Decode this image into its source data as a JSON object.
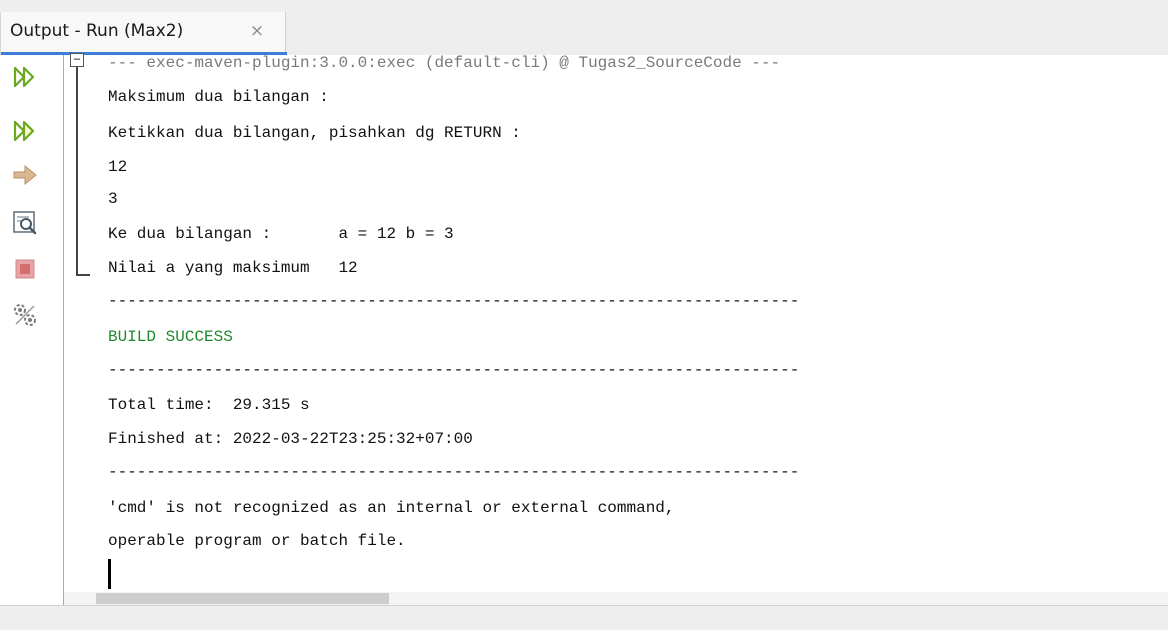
{
  "tab": {
    "title": "Output - Run (Max2)",
    "close_glyph": "×"
  },
  "toolbar": {
    "buttons": [
      {
        "name": "rerun-icon",
        "color": "#6aa820"
      },
      {
        "name": "rerun-with-params-icon",
        "color": "#6aa820"
      },
      {
        "name": "continue-arrow-icon",
        "color": "#c8a680"
      },
      {
        "name": "find-icon",
        "color": "#5d6b7a"
      },
      {
        "name": "stop-icon",
        "color": "#d06a6a"
      },
      {
        "name": "settings-icon",
        "color": "#7b7b7b"
      }
    ]
  },
  "output": {
    "lines": [
      "--- exec-maven-plugin:3.0.0:exec (default-cli) @ Tugas2_SourceCode ---",
      "Maksimum dua bilangan :",
      "Ketikkan dua bilangan, pisahkan dg RETURN :",
      "12",
      "3",
      "Ke dua bilangan :       a = 12 b = 3",
      "Nilai a yang maksimum   12",
      "------------------------------------------------------------------------",
      "BUILD SUCCESS",
      "------------------------------------------------------------------------",
      "Total time:  29.315 s",
      "Finished at: 2022-03-22T23:25:32+07:00",
      "------------------------------------------------------------------------",
      "'cmd' is not recognized as an internal or external command,",
      "operable program or batch file."
    ]
  },
  "fold_toggle_glyph": "−",
  "colors": {
    "tab_accent": "#3b7ed8",
    "success_text": "#1f8a2c",
    "text": "#111111"
  }
}
